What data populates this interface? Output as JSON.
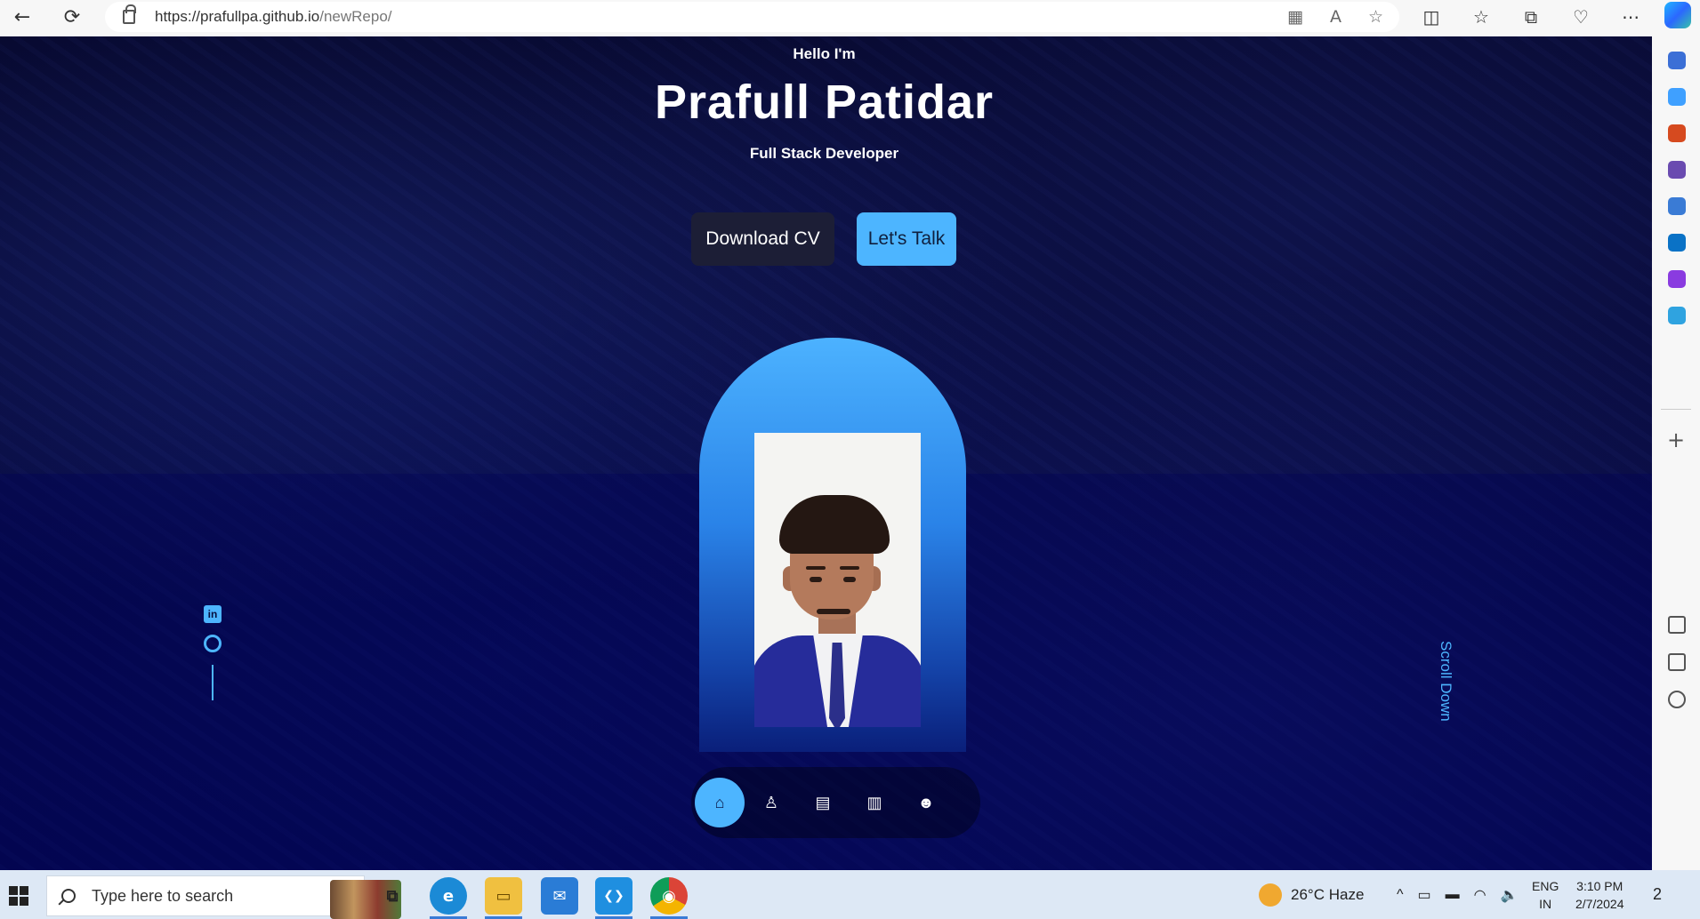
{
  "browser": {
    "url_host": "https://prafullpa.github.io",
    "url_path": "/newRepo/",
    "back_icon": "←",
    "reload_icon": "⟳",
    "address_icons": [
      "▦",
      "A",
      "☆"
    ],
    "chrome_icons": [
      "◫",
      "☆",
      "⧉",
      "♡",
      "⋯"
    ]
  },
  "hero": {
    "greeting": "Hello I'm",
    "name": "Prafull Patidar",
    "role": "Full Stack Developer",
    "download_cv": "Download CV",
    "lets_talk": "Let's Talk",
    "scroll_down": "Scroll Down",
    "linkedin_glyph": "in"
  },
  "dock": {
    "items": [
      "home",
      "about",
      "experience",
      "portfolio",
      "contact"
    ],
    "glyphs": [
      "⌂",
      "♙",
      "▤",
      "▥",
      "☻"
    ]
  },
  "sidebar": {
    "plus": "+",
    "icon_colors": [
      "#3b6fd6",
      "#3fa0ff",
      "#d64a1f",
      "#6a4bb0",
      "#3a7bd5",
      "#0a72c6",
      "#8a3be0",
      "#2fa3e0"
    ]
  },
  "taskbar": {
    "search_placeholder": "Type here to search",
    "weather": "26°C  Haze",
    "tray_icons": [
      "^",
      "▭",
      "▬",
      "◠",
      "🔈"
    ],
    "lang_top": "ENG",
    "lang_bottom": "IN",
    "time": "3:10 PM",
    "date": "2/7/2024",
    "notifications": "2",
    "apps": [
      "task-view",
      "edge",
      "file-explorer",
      "mail",
      "vscode",
      "chrome"
    ],
    "app_glyphs": [
      "⧉",
      "e",
      "▭",
      "✉",
      "❮❯",
      "◉"
    ]
  },
  "colors": {
    "accent": "#4db5ff",
    "background": "#06072b",
    "download_button": "#1c1e36"
  }
}
